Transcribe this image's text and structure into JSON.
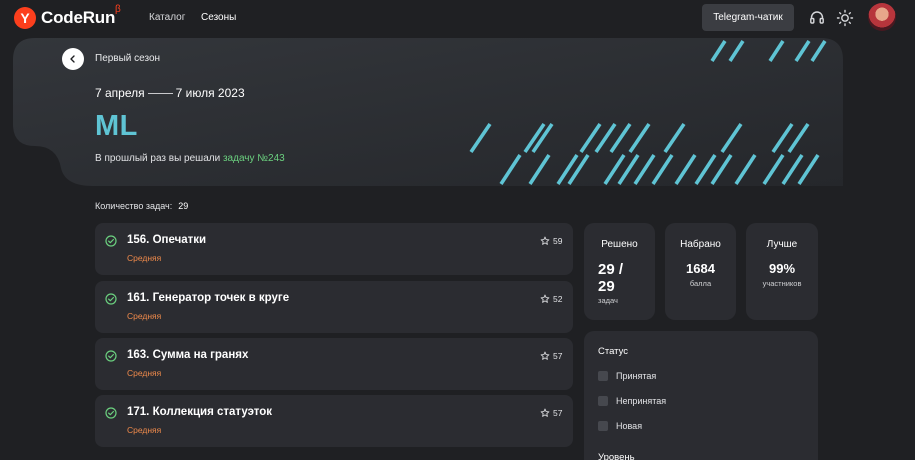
{
  "header": {
    "logo_letter": "Y",
    "logo_text": "CodeRun",
    "beta": "β",
    "nav": [
      "Каталог",
      "Сезоны"
    ],
    "telegram": "Telegram-чатик"
  },
  "hero": {
    "breadcrumb": "Первый сезон",
    "date_start": "7 апреля",
    "date_end": "7 июля 2023",
    "season": "ML",
    "last_text": "В прошлый раз вы решали",
    "last_link": "задачу №243"
  },
  "tasks_count_label": "Количество задач:",
  "tasks_count": "29",
  "tasks": [
    {
      "title": "156. Опечатки",
      "level": "Средняя",
      "rating": "59"
    },
    {
      "title": "161. Генератор точек в круге",
      "level": "Средняя",
      "rating": "52"
    },
    {
      "title": "163. Сумма на гранях",
      "level": "Средняя",
      "rating": "57"
    },
    {
      "title": "171. Коллекция статуэток",
      "level": "Средняя",
      "rating": "57"
    }
  ],
  "stats": {
    "solved": {
      "label": "Решено",
      "value_top": "29 /",
      "value_bottom": "29",
      "sub": "задач"
    },
    "scored": {
      "label": "Набрано",
      "value": "1684",
      "sub": "балла"
    },
    "better": {
      "label": "Лучше",
      "value": "99%",
      "sub": "участников"
    }
  },
  "filters": {
    "status_title": "Статус",
    "status_options": [
      "Принятая",
      "Непринятая",
      "Новая"
    ],
    "level_title": "Уровень"
  },
  "colors": {
    "accent": "#5fc4d4",
    "success": "#6bd07f",
    "medium": "#ef8a4b",
    "brand": "#fc3f1d"
  }
}
